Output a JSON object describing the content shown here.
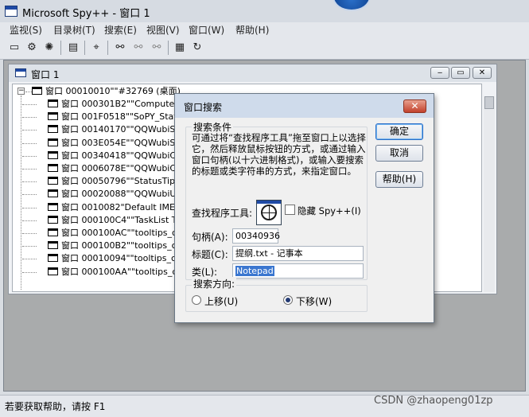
{
  "app": {
    "title": "Microsoft Spy++ - 窗口 1"
  },
  "menu": [
    "监视(S)",
    "目录树(T)",
    "搜索(E)",
    "视图(V)",
    "窗口(W)",
    "帮助(H)"
  ],
  "toolbar": {
    "icons": [
      "windows-icon",
      "processes-icon",
      "threads-icon",
      "messages-icon",
      "find-window-icon",
      "find-icon",
      "find-next-icon",
      "find-prev-icon",
      "properties-icon",
      "refresh-icon"
    ]
  },
  "child_window": {
    "title": "窗口 1",
    "buttons": [
      "‒",
      "▭",
      "✕"
    ],
    "tree": {
      "root": "窗口 00010010\"\"#32769 (桌面)",
      "expander": "−",
      "items": [
        "窗口 000301B2\"\"ComputerZF",
        "窗口 001F0518\"\"SoPY_Statu",
        "窗口 00140170\"\"QQWubiSta",
        "窗口 003E054E\"\"QQWubiSy",
        "窗口 00340418\"\"QQWubiCar",
        "窗口 0006078E\"\"QQWubiCor",
        "窗口 00050796\"\"StatusTips",
        "窗口 00020088\"\"QQWubiUIW",
        "窗口 0010082\"Default IME\"",
        "窗口 000100C4\"\"TaskList Thu",
        "窗口 000100AC\"\"tooltips_clas",
        "窗口 000100B2\"\"tooltips_clas",
        "窗口 00010094\"\"tooltips_clas",
        "窗口 000100AA\"\"tooltips_clas"
      ]
    }
  },
  "dialog": {
    "title": "窗口搜索",
    "close": "✕",
    "group_condition": "搜索条件",
    "description": "可通过将“查找程序工具”拖至窗口上以选择它，然后释放鼠标按钮的方式，或通过输入窗口句柄(以十六进制格式)，或输入要搜索的标题或类字符串的方式，来指定窗口。",
    "finder_label": "查找程序工具:",
    "hide_label": "隐藏 Spy++(I)",
    "handle_label": "句柄(A):",
    "handle_value": "00340936",
    "caption_label": "标题(C):",
    "caption_value": "提纲.txt - 记事本",
    "class_label": "类(L):",
    "class_value": "Notepad",
    "group_direction": "搜索方向:",
    "up_label": "上移(U)",
    "down_label": "下移(W)",
    "down_selected": true,
    "ok": "确定",
    "cancel": "取消",
    "help": "帮助(H)"
  },
  "status": {
    "text": "若要获取帮助，请按 F1"
  },
  "watermark": "CSDN @zhaopeng01zp"
}
